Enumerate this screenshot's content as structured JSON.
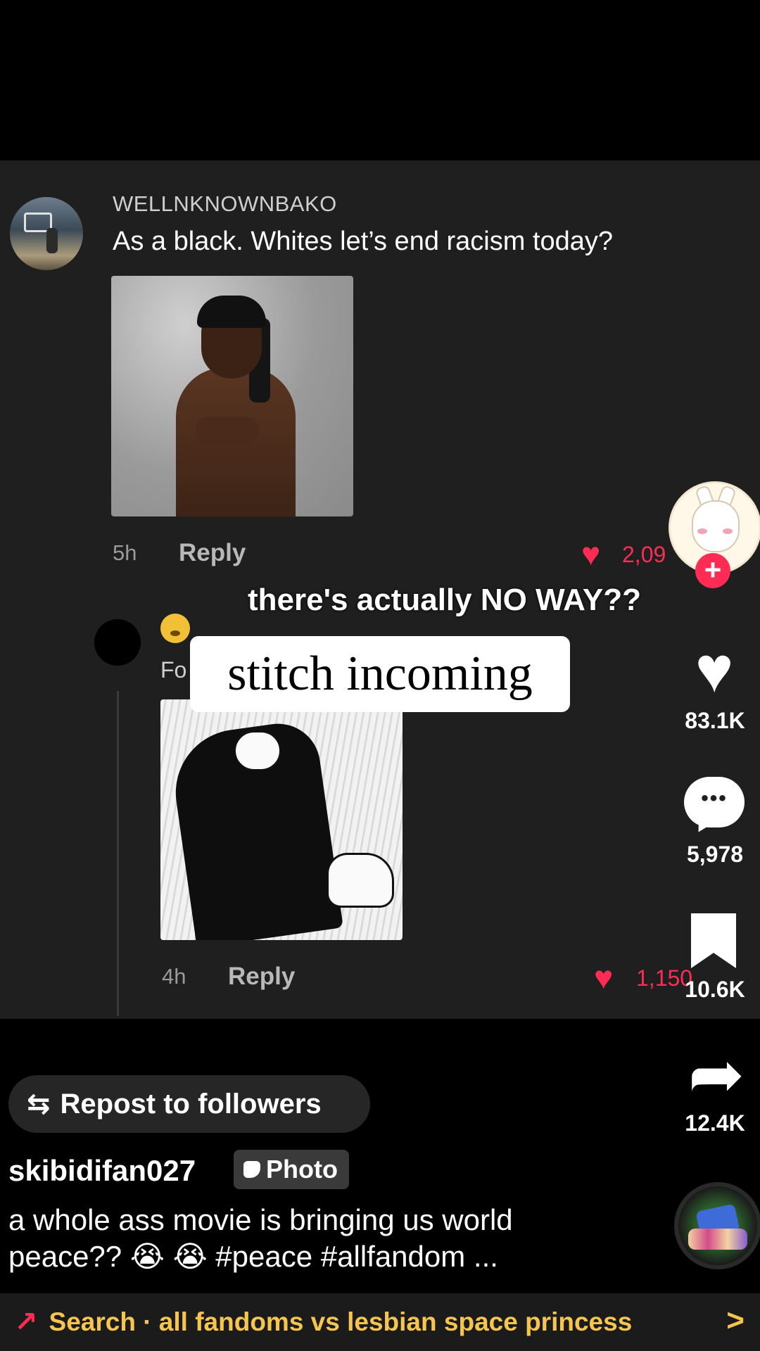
{
  "comments": [
    {
      "username": "WELLNKNOWNBAKO",
      "text": "As a black. Whites let’s end racism today?",
      "time": "5h",
      "reply_label": "Reply",
      "likes": "2,09"
    },
    {
      "username_fragment": "Fo",
      "time": "4h",
      "reply_label": "Reply",
      "likes": "1,150"
    }
  ],
  "video_overlay": {
    "caption_text": "there's actually NO WAY??",
    "stitch_text": "stitch incoming"
  },
  "actions": {
    "follow_symbol": "+",
    "likes": "83.1K",
    "comments": "5,978",
    "comment_dots": "•••",
    "bookmarks": "10.6K",
    "shares": "12.4K"
  },
  "repost": {
    "icon": "⇆",
    "label": "Repost to followers"
  },
  "post": {
    "author": "skibidifan027",
    "badge_label": "Photo",
    "caption": "a whole ass movie is bringing us world peace?? 😭 😭 #peace #allfandom ..."
  },
  "search": {
    "text": "Search · all fandoms vs lesbian space princess",
    "chevron": ">"
  },
  "colors": {
    "accent_red": "#fe2c55",
    "search_yellow": "#f6c54f",
    "panel_bg": "#1f1f1f"
  },
  "icons": {
    "like": "heart-icon",
    "comment": "comment-bubble-icon",
    "bookmark": "bookmark-icon",
    "share": "share-arrow-icon",
    "trend": "trending-icon"
  }
}
